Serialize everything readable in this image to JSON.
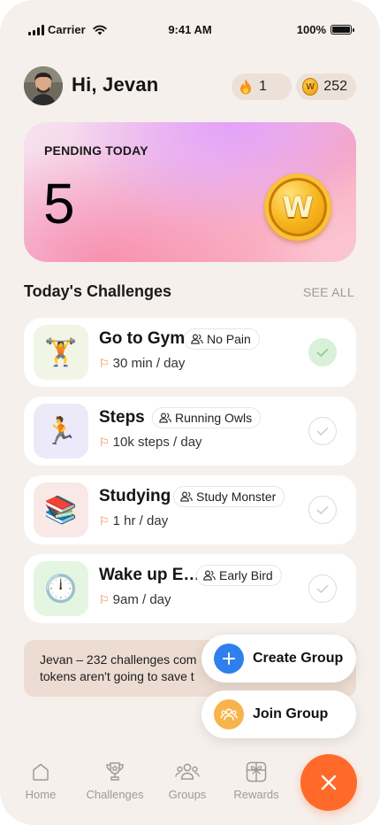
{
  "status_bar": {
    "carrier": "Carrier",
    "time": "9:41 AM",
    "battery": "100%",
    "battery_level": 1.0
  },
  "header": {
    "greeting": "Hi, Jevan",
    "streak_count": "1",
    "streak_icon": "flame-icon",
    "coin_count": "252",
    "coin_icon": "coin-icon"
  },
  "pending": {
    "label": "PENDING TODAY",
    "count": "5",
    "coin_letter": "W"
  },
  "challenges_section": {
    "title": "Today's Challenges",
    "see_all": "SEE ALL"
  },
  "challenges": [
    {
      "title": "Go to Gym",
      "group": "No Pain",
      "target": "30 min / day",
      "icon": "🏋️",
      "icon_bg": "#f1f5e5",
      "completed": true
    },
    {
      "title": "Steps",
      "group": "Running Owls",
      "target": "10k steps / day",
      "icon": "🏃",
      "icon_bg": "#eceaf8",
      "completed": false
    },
    {
      "title": "Studying",
      "group": "Study Monster",
      "target": "1 hr / day",
      "icon": "📚",
      "icon_bg": "#f8e8e6",
      "completed": false
    },
    {
      "title": "Wake up E…",
      "group": "Early Bird",
      "target": "9am / day",
      "icon": "🕛",
      "icon_bg": "#e4f6e1",
      "completed": false
    }
  ],
  "banner": {
    "line1": "Jevan – 232 challenges com",
    "line2": "tokens aren't going to save t"
  },
  "menu": {
    "create_label": "Create Group",
    "join_label": "Join Group"
  },
  "nav": {
    "home": "Home",
    "challenges": "Challenges",
    "groups": "Groups",
    "rewards": "Rewards"
  },
  "colors": {
    "background": "#f6f0ec",
    "accent_orange": "#ff6a2b",
    "create_blue": "#2f80ed",
    "join_yellow": "#f7b44a",
    "flag_orange": "#f46b2c",
    "done_green": "#d9f0d9"
  }
}
